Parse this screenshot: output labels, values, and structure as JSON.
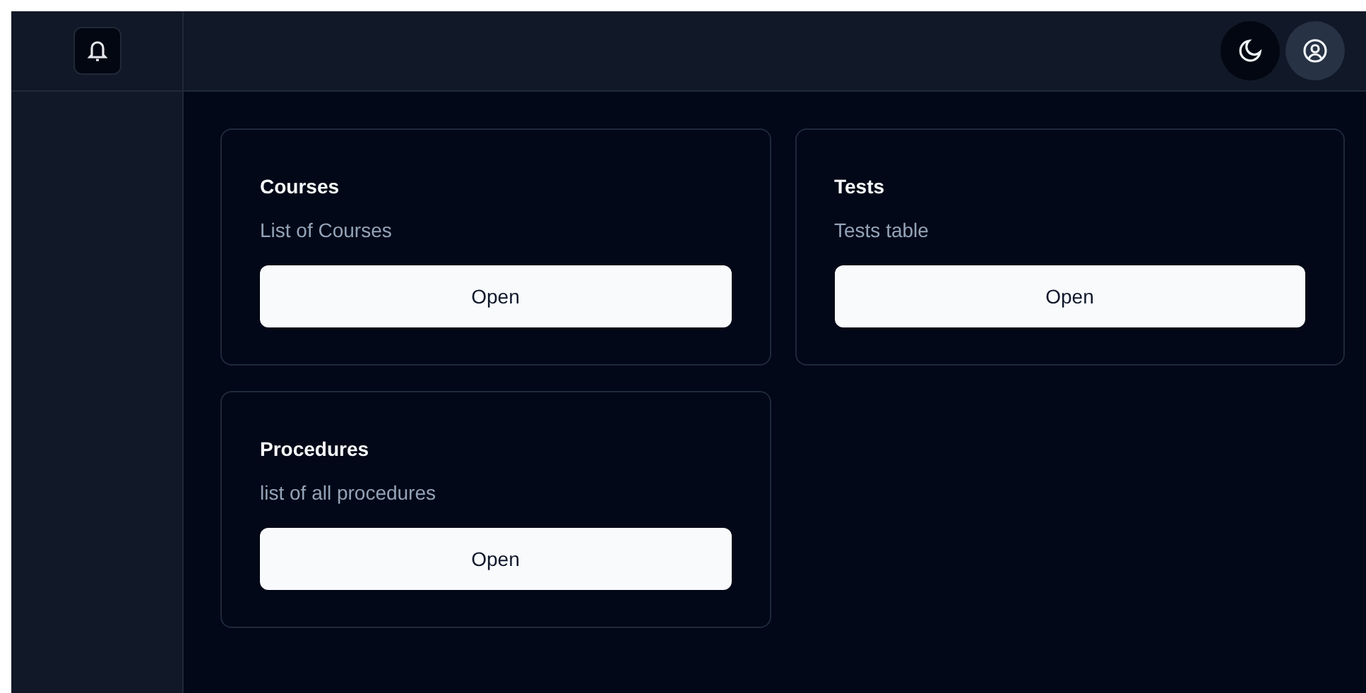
{
  "cards": [
    {
      "title": "Courses",
      "description": "List of Courses",
      "button": "Open"
    },
    {
      "title": "Tests",
      "description": "Tests table",
      "button": "Open"
    },
    {
      "title": "Procedures",
      "description": "list of all procedures",
      "button": "Open"
    }
  ]
}
